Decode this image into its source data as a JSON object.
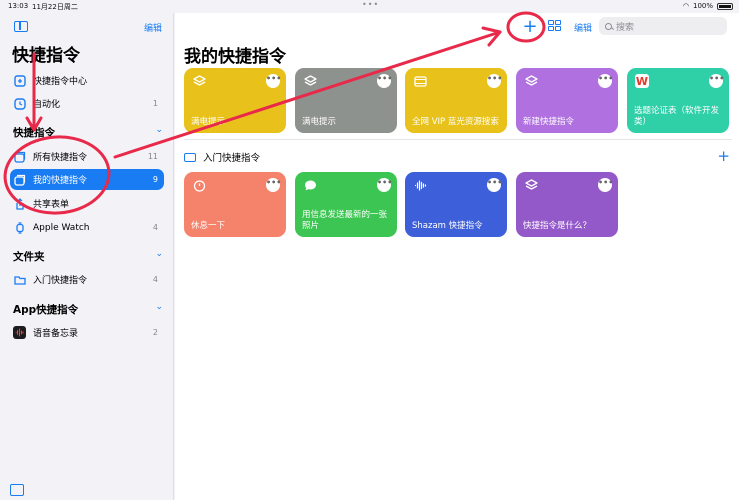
{
  "status_bar": {
    "time": "13:03",
    "date": "11月22日周二",
    "battery": "100%"
  },
  "sidebar": {
    "edit_label": "编辑",
    "title": "快捷指令",
    "top_items": [
      {
        "label": "快捷指令中心",
        "count": ""
      },
      {
        "label": "自动化",
        "count": "1"
      }
    ],
    "sections": [
      {
        "title": "快捷指令",
        "items": [
          {
            "label": "所有快捷指令",
            "count": "11"
          },
          {
            "label": "我的快捷指令",
            "count": "9",
            "selected": true
          },
          {
            "label": "共享表单",
            "count": ""
          },
          {
            "label": "Apple Watch",
            "count": "4"
          }
        ]
      },
      {
        "title": "文件夹",
        "items": [
          {
            "label": "入门快捷指令",
            "count": "4"
          }
        ]
      },
      {
        "title": "App快捷指令",
        "items": [
          {
            "label": "语音备忘录",
            "count": "2"
          }
        ]
      }
    ]
  },
  "toolbar": {
    "edit_label": "编辑",
    "search_placeholder": "搜索"
  },
  "main": {
    "title": "我的快捷指令",
    "tiles_row1": [
      {
        "title": "满电提示",
        "color": "#e8c21a",
        "icon": "layers-icon"
      },
      {
        "title": "满电提示",
        "color": "#8e928e",
        "icon": "layers-icon"
      },
      {
        "title": "全网 VIP 蓝光资源搜索",
        "color": "#e8c21a",
        "icon": "film-icon"
      },
      {
        "title": "新建快捷指令",
        "color": "#b070e0",
        "icon": "layers-icon"
      },
      {
        "title": "选题论证表（软件开发类）",
        "color": "#2fcfa8",
        "icon": "wps-icon",
        "icon_text": "W"
      }
    ],
    "folder": {
      "label": "入门快捷指令"
    },
    "tiles_row2": [
      {
        "title": "休息一下",
        "color": "#f5826b",
        "icon": "timer-icon"
      },
      {
        "title": "用信息发送最新的一张照片",
        "color": "#3cc552",
        "icon": "message-icon"
      },
      {
        "title": "Shazam 快捷指令",
        "color": "#3d5fd9",
        "icon": "waveform-icon"
      },
      {
        "title": "快捷指令是什么？",
        "color": "#9459c9",
        "icon": "layers-icon"
      }
    ]
  }
}
